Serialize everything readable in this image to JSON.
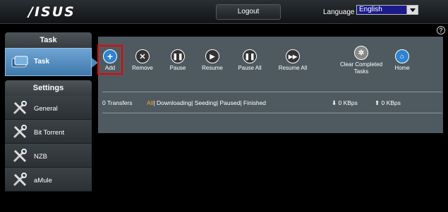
{
  "header": {
    "logo": "/ISUS",
    "logout_label": "Logout",
    "language_label": "Language",
    "language_selected": "English"
  },
  "sidebar": {
    "task_header": "Task",
    "task_item": "Task",
    "settings_header": "Settings",
    "items": [
      {
        "label": "General"
      },
      {
        "label": "Bit Torrent"
      },
      {
        "label": "NZB"
      },
      {
        "label": "aMule"
      }
    ]
  },
  "toolbar": {
    "buttons": [
      {
        "label": "Add",
        "icon": "plus-icon"
      },
      {
        "label": "Remove",
        "icon": "x-icon"
      },
      {
        "label": "Pause",
        "icon": "pause-icon"
      },
      {
        "label": "Resume",
        "icon": "play-icon"
      },
      {
        "label": "Pause All",
        "icon": "pause-all-icon"
      },
      {
        "label": "Resume All",
        "icon": "resume-all-icon"
      },
      {
        "label": "Clear Completed Tasks",
        "icon": "clear-icon"
      },
      {
        "label": "Home",
        "icon": "home-icon"
      }
    ]
  },
  "status": {
    "transfers": "0 Transfers",
    "filter_all": "All",
    "filter_rest": "| Downloading| Seeding| Paused| Finished",
    "download_speed": "0 KBps",
    "upload_speed": "0 KBps"
  },
  "colors": {
    "accent_blue": "#3f78ab",
    "panel": "#4e5a60",
    "filter_active": "#f3a51f",
    "highlight_border": "#e00"
  }
}
